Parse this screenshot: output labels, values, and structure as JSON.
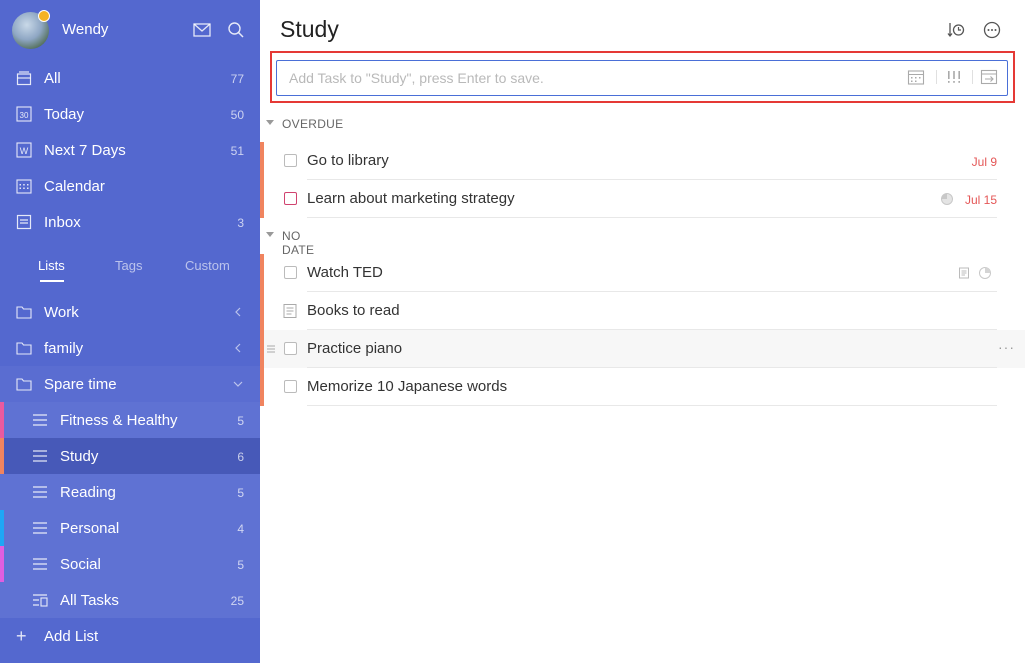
{
  "colors": {
    "sidebar_bg": "#5468cf",
    "accent": "#4a6fd7",
    "date_red": "#e45656",
    "highlight": "#e53935",
    "prio_orange": "#f0845f",
    "prio_pink": "#e95a9f",
    "prio_blue": "#1ea7f5",
    "prio_magenta": "#e05ee0"
  },
  "profile": {
    "name": "Wendy",
    "icons": [
      "mail-icon",
      "search-icon"
    ]
  },
  "nav": [
    {
      "label": "All",
      "count": "77",
      "icon": "inbox-stack-icon"
    },
    {
      "label": "Today",
      "count": "50",
      "icon": "calendar-30-icon",
      "icon_text": "30"
    },
    {
      "label": "Next 7 Days",
      "count": "51",
      "icon": "calendar-week-icon",
      "icon_text": "W"
    },
    {
      "label": "Calendar",
      "count": "",
      "icon": "calendar-grid-icon"
    },
    {
      "label": "Inbox",
      "count": "3",
      "icon": "inbox-icon"
    }
  ],
  "tabs": [
    {
      "label": "Lists",
      "active": true
    },
    {
      "label": "Tags",
      "active": false
    },
    {
      "label": "Custom",
      "active": false
    }
  ],
  "folders": [
    {
      "label": "Work",
      "state": "collapsed"
    },
    {
      "label": "family",
      "state": "collapsed"
    },
    {
      "label": "Spare time",
      "state": "expanded"
    }
  ],
  "lists": [
    {
      "label": "Fitness & Healthy",
      "count": "5",
      "color": "#e95a9f"
    },
    {
      "label": "Study",
      "count": "6",
      "color": "#f0845f",
      "active": true
    },
    {
      "label": "Reading",
      "count": "5",
      "color": ""
    },
    {
      "label": "Personal",
      "count": "4",
      "color": "#1ea7f5"
    },
    {
      "label": "Social",
      "count": "5",
      "color": "#e05ee0"
    },
    {
      "label": "All Tasks",
      "count": "25",
      "color": ""
    }
  ],
  "add_list_label": "Add List",
  "main": {
    "title": "Study",
    "add_task_placeholder": "Add Task to \"Study\", press Enter to save.",
    "input_icons": [
      "calendar-icon",
      "priority-icon",
      "list-move-icon"
    ]
  },
  "sections": [
    {
      "label": "OVERDUE"
    },
    {
      "label": "NO DATE"
    }
  ],
  "tasks": [
    {
      "title": "Go to library",
      "date": "Jul 9",
      "section": "OVERDUE"
    },
    {
      "title": "Learn about marketing strategy",
      "date": "Jul 15",
      "section": "OVERDUE"
    },
    {
      "title": "Watch TED",
      "date": "",
      "section": "NO DATE"
    },
    {
      "title": "Books to read",
      "date": "",
      "section": "NO DATE"
    },
    {
      "title": "Practice piano",
      "date": "",
      "section": "NO DATE"
    },
    {
      "title": "Memorize 10 Japanese words",
      "date": "",
      "section": "NO DATE"
    }
  ]
}
